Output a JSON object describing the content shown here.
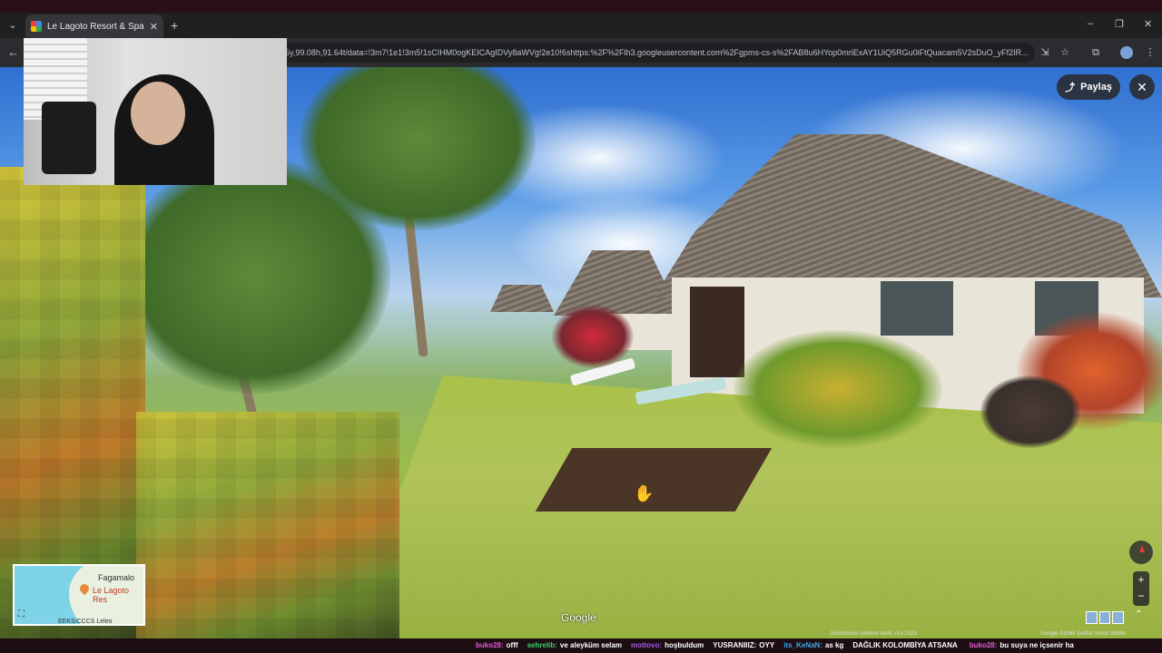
{
  "browser": {
    "tab_title": "Le Lagoto Resort & Spa - Goog",
    "tab_close": "✕",
    "new_tab": "+",
    "url": "5y,99.08h,91.64t/data=!3m7!1e1!3m5!1sCIHM0ogKEICAgIDVy8aWVg!2e10!6shttps:%2F%2Flh3.googleusercontent.com%2Fgpms-cs-s%2FAB8u6HYop0mriExAY1UiQ5RGu0iFtQuacam5V2sDuO_yFf2IR...",
    "window_controls": [
      "–",
      "❐",
      "✕"
    ]
  },
  "streetview": {
    "share_label": "Paylaş",
    "close_label": "✕",
    "google_logo": "Google",
    "image_date": "Görüntünün çekilme tarihi: Ara 2023",
    "footer_links": "Google  Gizlilik  Şartlar  Sorun bildirin",
    "zoom_in": "+",
    "zoom_out": "−",
    "expand": "⌃"
  },
  "minimap": {
    "place_name": "Fagamalo",
    "hotel_name": "Le Lagoto Res",
    "attribution": "EEKS/CCCS Leleo",
    "expand_icon": "⛶"
  },
  "chat": [
    {
      "user": "buko28:",
      "msg": "offf",
      "color": "#e35bd6"
    },
    {
      "user": "sehrelib:",
      "msg": "ve aleyküm selam",
      "color": "#3ad06b"
    },
    {
      "user": "mottovo:",
      "msg": "hoşbuldum",
      "color": "#a35be3"
    },
    {
      "user": "YUSRANIIIZ:",
      "msg": "OYY",
      "color": "#ffffff"
    },
    {
      "user": "its_KeNaN:",
      "msg": "as kg",
      "color": "#3aa8e3"
    },
    {
      "user": "DAĞLIK KOLOMBİYA ATSANA",
      "msg": "",
      "color": "#ffffff"
    },
    {
      "user": "buko28:",
      "msg": "bu suya ne içsenir ha",
      "color": "#e35bd6"
    }
  ],
  "colors": {
    "ticker_bg": "#1b0d12",
    "accent": "#e53935"
  }
}
